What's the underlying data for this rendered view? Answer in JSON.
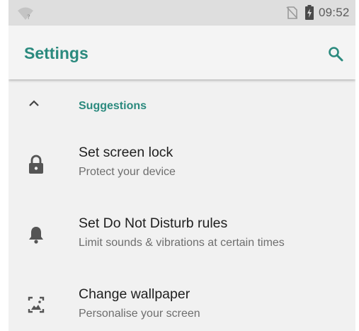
{
  "status_bar": {
    "time": "09:52",
    "icons": [
      "wifi-question-icon",
      "no-sim-icon",
      "battery-charging-icon"
    ]
  },
  "app_bar": {
    "title": "Settings",
    "search_icon": "search-icon"
  },
  "colors": {
    "accent": "#2b8a7e",
    "background": "#f1f1f1",
    "status_bar": "#dedede",
    "primary_text": "#202020",
    "secondary_text": "#6e6e6e",
    "icon": "#555555"
  },
  "suggestions": {
    "header_label": "Suggestions",
    "collapse_icon": "chevron-up-icon",
    "items": [
      {
        "title": "Set screen lock",
        "subtitle": "Protect your device",
        "icon": "lock-icon"
      },
      {
        "title": "Set Do Not Disturb rules",
        "subtitle": "Limit sounds & vibrations at certain times",
        "icon": "bell-icon"
      },
      {
        "title": "Change wallpaper",
        "subtitle": "Personalise your screen",
        "icon": "wallpaper-icon"
      }
    ]
  }
}
